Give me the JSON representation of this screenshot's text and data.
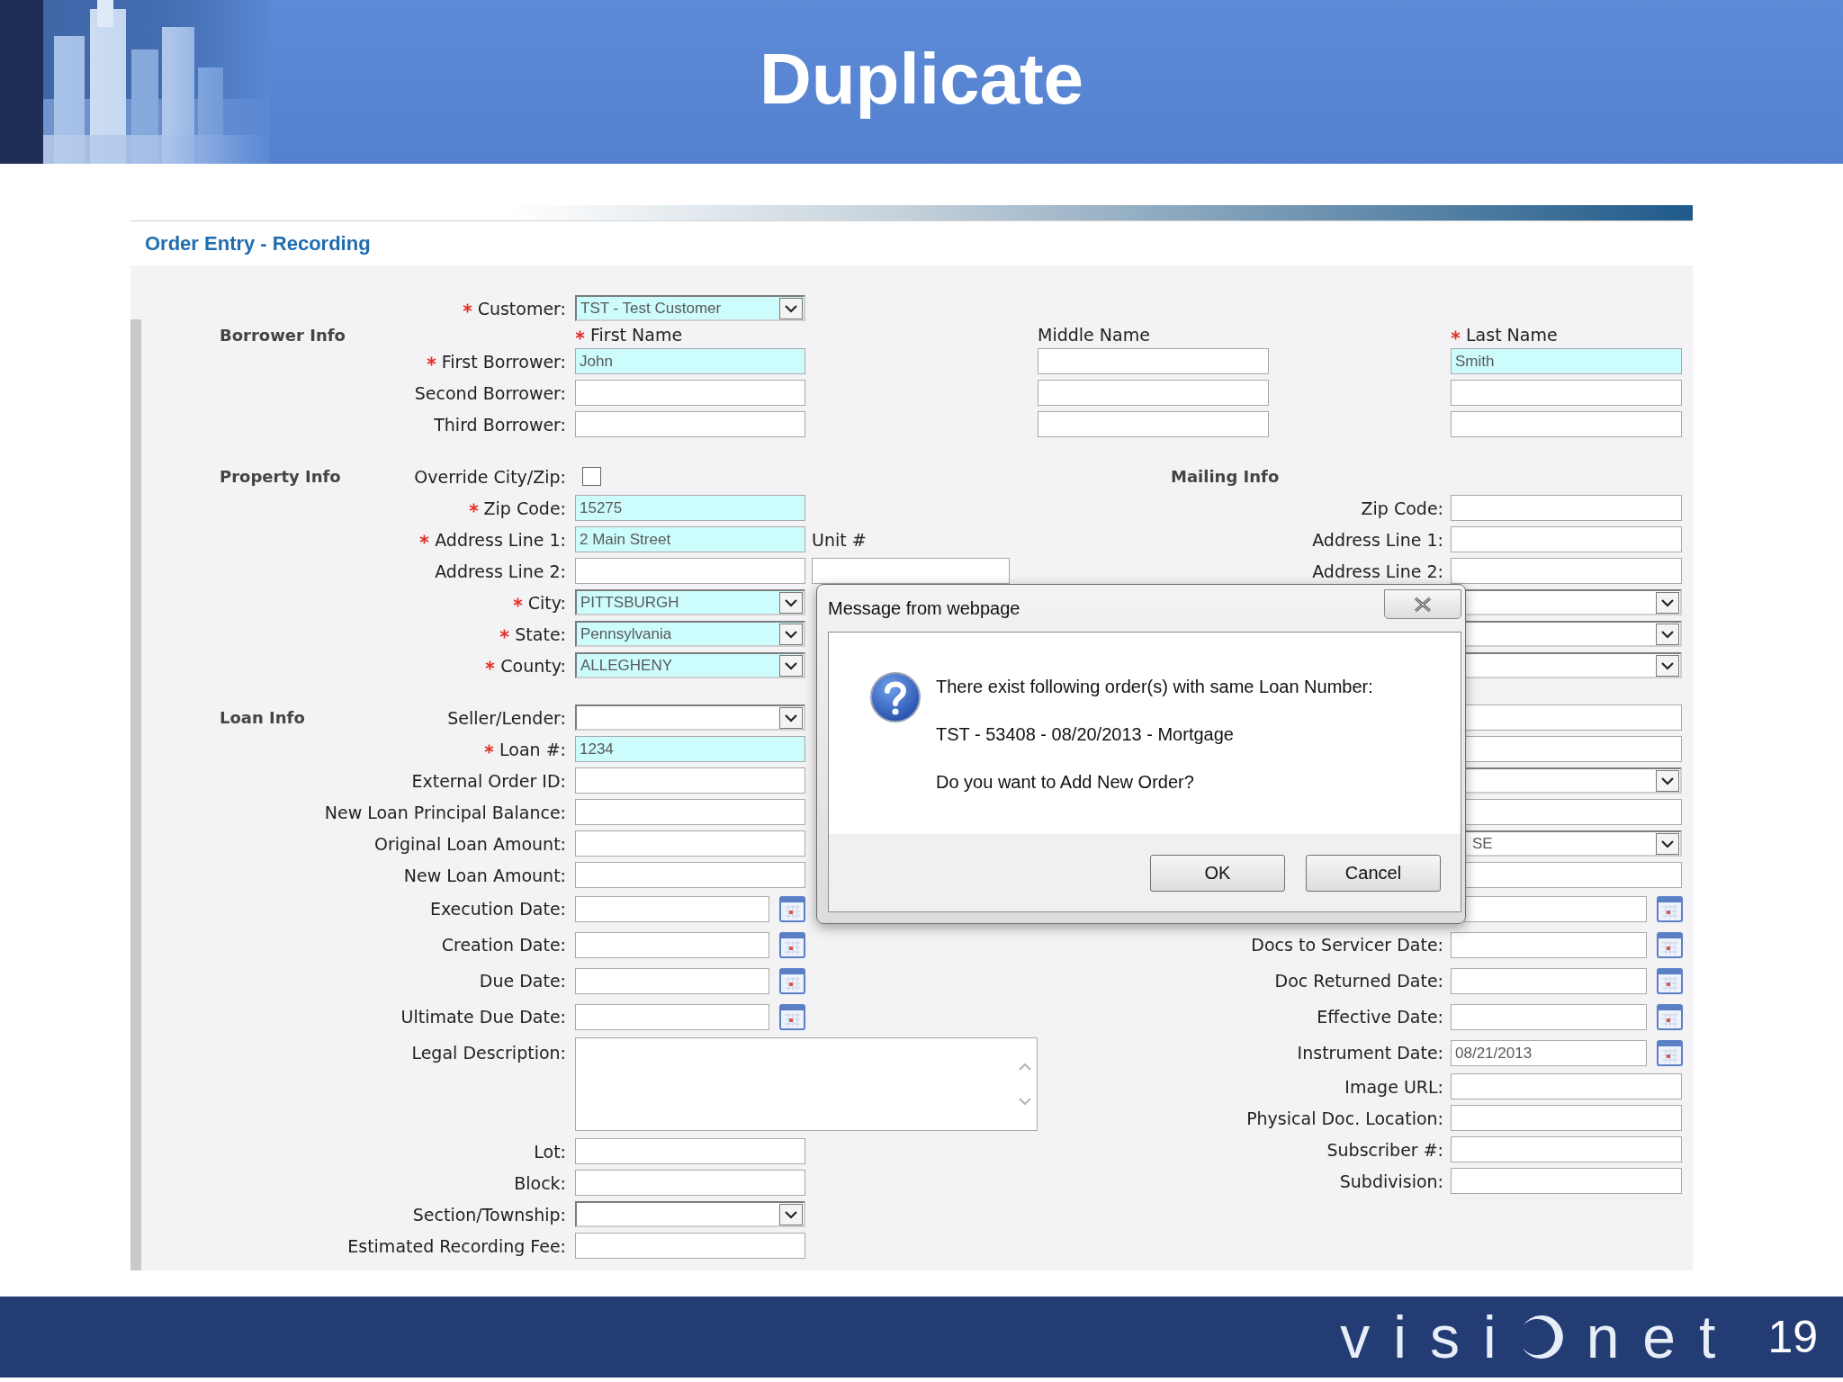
{
  "slide": {
    "title": "Duplicate",
    "logo": {
      "before": "visi",
      "after": "net"
    },
    "page_number": "19"
  },
  "app": {
    "heading": "Order Entry - Recording",
    "left_groups": [
      {
        "rows": [
          {
            "kind": "select",
            "label": "Customer:",
            "required": true,
            "value": "TST - Test Customer"
          },
          {
            "kind": "column-header",
            "section": "Borrower Info",
            "text": "First Name",
            "required": true
          },
          {
            "kind": "text",
            "label": "First Borrower:",
            "required": true,
            "value": "John"
          },
          {
            "kind": "text",
            "label": "Second Borrower:",
            "required": false
          },
          {
            "kind": "text",
            "label": "Third Borrower:",
            "required": false
          }
        ]
      },
      {
        "rows": [
          {
            "kind": "checkbox",
            "section": "Property Info",
            "label": "Override City/Zip:",
            "checked": false
          },
          {
            "kind": "text",
            "label": "Zip Code:",
            "required": true,
            "value": "15275"
          },
          {
            "kind": "text",
            "label": "Address Line 1:",
            "required": true,
            "value": "2 Main Street",
            "extra": {
              "kind": "label",
              "text": "Unit #"
            }
          },
          {
            "kind": "text",
            "label": "Address Line 2:",
            "required": false,
            "extra": {
              "kind": "input"
            }
          },
          {
            "kind": "select",
            "label": "City:",
            "required": true,
            "value": "PITTSBURGH"
          },
          {
            "kind": "select",
            "label": "State:",
            "required": true,
            "value": "Pennsylvania"
          },
          {
            "kind": "select",
            "label": "County:",
            "required": true,
            "value": "ALLEGHENY"
          }
        ]
      },
      {
        "rows": [
          {
            "kind": "select",
            "section": "Loan Info",
            "label": "Seller/Lender:",
            "required": false
          },
          {
            "kind": "text",
            "label": "Loan #:",
            "required": true,
            "value": "1234"
          },
          {
            "kind": "text",
            "label": "External Order ID:",
            "required": false
          },
          {
            "kind": "text",
            "label": "New Loan Principal Balance:",
            "required": false
          },
          {
            "kind": "text",
            "label": "Original Loan Amount:",
            "required": false
          },
          {
            "kind": "text",
            "label": "New Loan Amount:",
            "required": false
          },
          {
            "kind": "date",
            "label": "Execution Date:",
            "required": false
          },
          {
            "kind": "date",
            "label": "Creation Date:",
            "required": false
          },
          {
            "kind": "date",
            "label": "Due Date:",
            "required": false
          },
          {
            "kind": "date",
            "label": "Ultimate Due Date:",
            "required": false
          },
          {
            "kind": "textarea",
            "label": "Legal Description:",
            "required": false
          },
          {
            "kind": "text",
            "label": "Lot:",
            "required": false
          },
          {
            "kind": "text",
            "label": "Block:",
            "required": false
          },
          {
            "kind": "select",
            "label": "Section/Township:",
            "required": false
          },
          {
            "kind": "text",
            "label": "Estimated Recording Fee:",
            "required": false
          }
        ]
      }
    ],
    "right_groups": [
      {
        "rows": [
          {
            "kind": "column-header-pair",
            "columns": [
              {
                "text": "Middle Name",
                "required": false
              },
              {
                "text": "Last Name",
                "required": true
              }
            ]
          },
          {
            "kind": "name-pair",
            "inputs": [
              {
                "required": false
              },
              {
                "required": true,
                "value": "Smith"
              }
            ]
          },
          {
            "kind": "name-pair",
            "inputs": [
              {
                "required": false
              },
              {
                "required": false
              }
            ]
          },
          {
            "kind": "name-pair",
            "inputs": [
              {
                "required": false
              },
              {
                "required": false
              }
            ]
          }
        ]
      },
      {
        "rows": [
          {
            "kind": "heading",
            "text": "Mailing Info"
          },
          {
            "kind": "text",
            "label": "Zip Code:",
            "required": false
          },
          {
            "kind": "text",
            "label": "Address Line 1:",
            "required": false
          },
          {
            "kind": "text",
            "label": "Address Line 2:",
            "required": false
          },
          {
            "kind": "select",
            "required": false
          },
          {
            "kind": "select",
            "required": false
          },
          {
            "kind": "select",
            "required": false
          }
        ]
      },
      {
        "rows": [
          {
            "kind": "text",
            "required": false
          },
          {
            "kind": "text",
            "required": false
          },
          {
            "kind": "select",
            "required": false
          },
          {
            "kind": "text",
            "required": false
          },
          {
            "kind": "select",
            "required": false,
            "value": "SE"
          },
          {
            "kind": "text",
            "required": false
          },
          {
            "kind": "date",
            "required": false
          },
          {
            "kind": "date",
            "label": "Docs to Servicer Date:",
            "required": false
          },
          {
            "kind": "date",
            "label": "Doc Returned Date:",
            "required": false
          },
          {
            "kind": "date",
            "label": "Effective Date:",
            "required": false
          },
          {
            "kind": "date",
            "label": "Instrument Date:",
            "required": false,
            "value": "08/21/2013"
          },
          {
            "kind": "text",
            "label": "Image URL:",
            "required": false
          },
          {
            "kind": "text",
            "label": "Physical Doc. Location:",
            "required": false
          },
          {
            "kind": "text",
            "label": "Subscriber #:",
            "required": false
          },
          {
            "kind": "text",
            "label": "Subdivision:",
            "required": false
          }
        ]
      }
    ]
  },
  "dialog": {
    "title": "Message from webpage",
    "lines": [
      "There exist following order(s) with same Loan Number:",
      "TST - 53408 - 08/20/2013 - Mortgage",
      "Do you want to Add New Order?"
    ],
    "buttons": [
      "OK",
      "Cancel"
    ]
  }
}
